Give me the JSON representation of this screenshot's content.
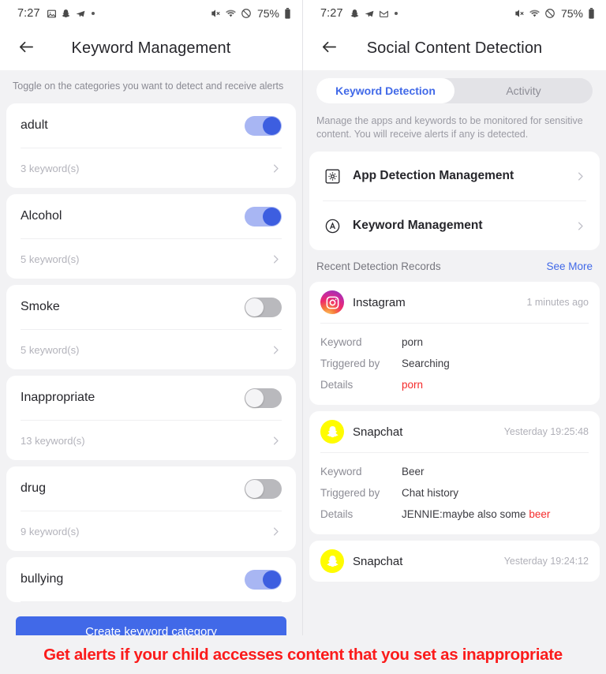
{
  "left": {
    "status_bar": {
      "time": "7:27",
      "left_icons": [
        "image-icon",
        "snapchat-ghost-icon",
        "paper-plane-icon",
        "dot-icon"
      ],
      "right_icons": [
        "mute-icon",
        "wifi-icon",
        "do-not-disturb-icon"
      ],
      "battery_percent": "75%"
    },
    "title": "Keyword Management",
    "back_icon": "arrow-left-icon",
    "hint": "Toggle on the categories you want to detect and receive alerts",
    "categories": [
      {
        "name": "adult",
        "count": "3 keyword(s)",
        "enabled": true
      },
      {
        "name": "Alcohol",
        "count": "5 keyword(s)",
        "enabled": true
      },
      {
        "name": "Smoke",
        "count": "5 keyword(s)",
        "enabled": false
      },
      {
        "name": "Inappropriate",
        "count": "13 keyword(s)",
        "enabled": false
      },
      {
        "name": "drug",
        "count": "9 keyword(s)",
        "enabled": false
      },
      {
        "name": "bullying",
        "count": "",
        "enabled": true
      }
    ],
    "create_button": "Create keyword category"
  },
  "right": {
    "status_bar": {
      "time": "7:27",
      "left_icons": [
        "snapchat-ghost-icon",
        "paper-plane-icon",
        "gmail-icon",
        "dot-icon"
      ],
      "right_icons": [
        "mute-icon",
        "wifi-icon",
        "do-not-disturb-icon"
      ],
      "battery_percent": "75%"
    },
    "title": "Social Content Detection",
    "back_icon": "arrow-left-icon",
    "tabs": [
      {
        "label": "Keyword Detection",
        "active": true
      },
      {
        "label": "Activity",
        "active": false
      }
    ],
    "description": "Manage the apps and keywords to be monitored for sensitive content. You will receive alerts if any is detected.",
    "menu": [
      {
        "label": "App Detection Management",
        "icon": "gear-square-icon"
      },
      {
        "label": "Keyword Management",
        "icon": "circle-a-icon"
      }
    ],
    "records_header": {
      "title": "Recent Detection Records",
      "see_more": "See More"
    },
    "records": [
      {
        "app": "Instagram",
        "app_icon": "instagram-icon",
        "time": "1 minutes ago",
        "fields": [
          {
            "label": "Keyword",
            "value": "porn",
            "alert": false
          },
          {
            "label": "Triggered by",
            "value": "Searching",
            "alert": false
          },
          {
            "label": "Details",
            "value": "porn",
            "alert": true
          }
        ]
      },
      {
        "app": "Snapchat",
        "app_icon": "snapchat-icon",
        "time": "Yesterday 19:25:48",
        "fields": [
          {
            "label": "Keyword",
            "value": "Beer",
            "alert": false
          },
          {
            "label": "Triggered by",
            "value": "Chat history",
            "alert": false
          },
          {
            "label": "Details",
            "value": "JENNIE:maybe also some ",
            "highlight": "beer",
            "alert": false
          }
        ]
      },
      {
        "app": "Snapchat",
        "app_icon": "snapchat-icon",
        "time": "Yesterday 19:24:12",
        "fields": []
      }
    ]
  },
  "banner": {
    "text": "Get alerts if your child accesses content that you set as inappropriate",
    "color": "#fb1b1b"
  },
  "colors": {
    "accent_blue": "#4169e8",
    "toggle_on_track": "#a8b6f3",
    "toggle_on_knob": "#3d5ee0",
    "toggle_off_track": "#b9b9bd",
    "alert_red": "#f52b2b",
    "page_bg": "#f2f2f4"
  }
}
